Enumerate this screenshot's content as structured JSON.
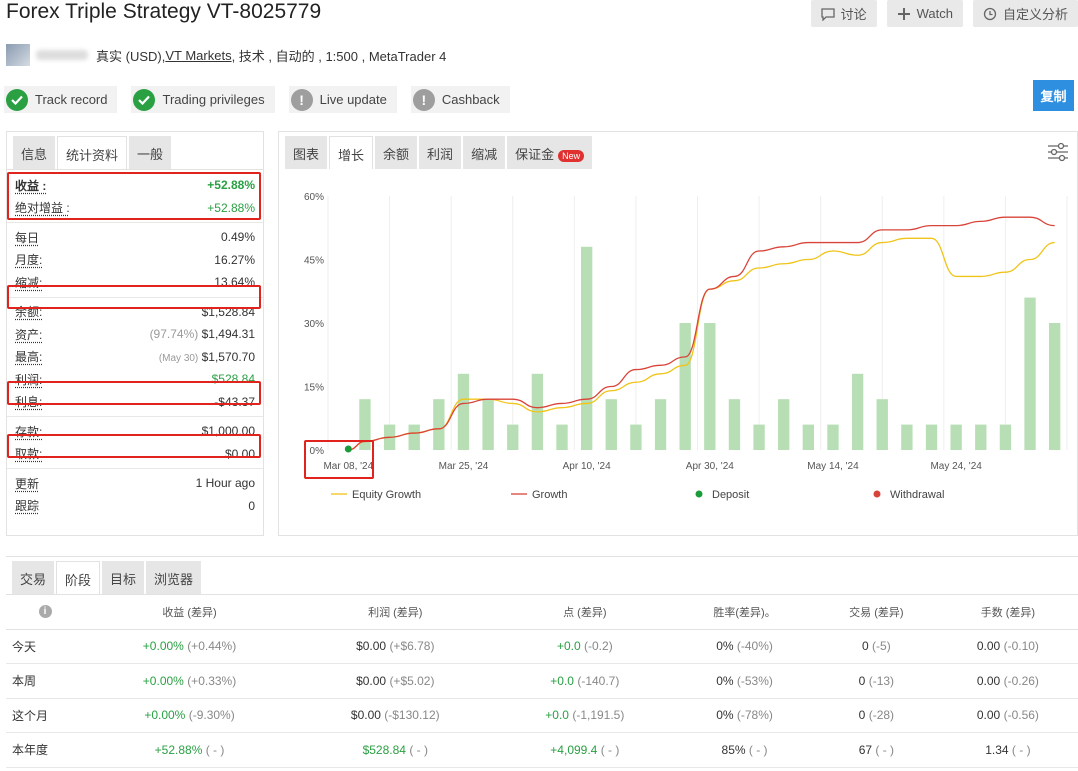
{
  "header": {
    "title": "Forex Triple Strategy VT-8025779",
    "discuss": "讨论",
    "watch": "Watch",
    "custom": "自定义分析"
  },
  "sub": {
    "prefix": "真实 (USD), ",
    "broker": "VT Markets",
    "suffix": " , 技术 , 自动的 , 1:500 , MetaTrader 4"
  },
  "badges": [
    {
      "label": "Track record",
      "status": "ok"
    },
    {
      "label": "Trading privileges",
      "status": "ok"
    },
    {
      "label": "Live update",
      "status": "warn"
    },
    {
      "label": "Cashback",
      "status": "warn"
    }
  ],
  "copy_label": "复制",
  "left_tabs": [
    "信息",
    "统计资料",
    "一般"
  ],
  "stats": {
    "gain": {
      "label": "收益 :",
      "value": "+52.88%"
    },
    "abs_gain": {
      "label": "绝对增益 :",
      "value": "+52.88%"
    },
    "daily": {
      "label": "每日",
      "value": "0.49%"
    },
    "monthly": {
      "label": "月度:",
      "value": "16.27%"
    },
    "drawdown": {
      "label": "缩减:",
      "value": "13.64%"
    },
    "balance": {
      "label": "余额:",
      "value": "$1,528.84"
    },
    "equity": {
      "label": "资产:",
      "pct": "(97.74%)",
      "value": "$1,494.31"
    },
    "highest": {
      "label": "最高:",
      "date": "(May 30)",
      "value": "$1,570.70"
    },
    "profit": {
      "label": "利润:",
      "value": "$528.84"
    },
    "interest": {
      "label": "利息:",
      "value": "-$43.37"
    },
    "deposits": {
      "label": "存款:",
      "value": "$1,000.00"
    },
    "withdrawals": {
      "label": "取款:",
      "value": "$0.00"
    },
    "updated": {
      "label": "更新",
      "value": "1 Hour ago"
    },
    "tracking": {
      "label": "跟踪",
      "value": "0"
    }
  },
  "chart_tabs": [
    "图表",
    "增长",
    "余额",
    "利润",
    "缩减",
    "保证金"
  ],
  "new_badge": "New",
  "chart_data": {
    "type": "line",
    "yticks": [
      "60%",
      "45%",
      "30%",
      "15%",
      "0%"
    ],
    "ylim": [
      0,
      60
    ],
    "xticks": [
      "Mar 08, '24",
      "Mar 25, '24",
      "Apr 10, '24",
      "Apr 30, '24",
      "May 14, '24",
      "May 24, '24"
    ],
    "legend": [
      "Equity Growth",
      "Growth",
      "Deposit",
      "Withdrawal"
    ],
    "colors": {
      "equity": "#f0c419",
      "growth": "#d9443a",
      "deposit": "#1a9c3a",
      "withdrawal": "#d9443a",
      "bars": "#b7deb4"
    },
    "bars": [
      0,
      12,
      6,
      6,
      12,
      18,
      12,
      6,
      18,
      6,
      48,
      12,
      6,
      12,
      30,
      30,
      12,
      6,
      12,
      6,
      6,
      18,
      12,
      6,
      6,
      6,
      6,
      6,
      36,
      30
    ],
    "equity_growth": [
      0,
      2,
      3,
      4,
      5,
      12,
      12,
      11,
      9,
      10,
      11,
      14,
      16,
      18,
      20,
      38,
      40,
      43,
      44,
      45,
      47,
      46,
      49,
      50,
      50,
      41,
      41,
      42,
      45,
      49
    ],
    "growth": [
      0,
      2,
      3,
      4,
      5,
      11,
      12,
      12,
      10,
      11,
      12,
      15,
      19,
      20,
      22,
      38,
      41,
      47,
      48,
      49,
      49,
      49,
      52,
      52,
      53,
      53,
      54,
      55,
      55,
      53
    ]
  },
  "bottom_tabs": [
    "交易",
    "阶段",
    "目标",
    "浏览器"
  ],
  "table": {
    "headers": [
      "收益 (差异)",
      "利润 (差异)",
      "点 (差异)",
      "胜率(差异)。",
      "交易 (差异)",
      "手数 (差异)"
    ],
    "rows": [
      {
        "period": "今天",
        "cells": [
          [
            "+0.00%",
            "(+0.44%)"
          ],
          [
            "$0.00",
            "(+$6.78)"
          ],
          [
            "+0.0",
            "(-0.2)"
          ],
          [
            "0%",
            "(-40%)"
          ],
          [
            "0",
            "(-5)"
          ],
          [
            "0.00",
            "(-0.10)"
          ]
        ]
      },
      {
        "period": "本周",
        "cells": [
          [
            "+0.00%",
            "(+0.33%)"
          ],
          [
            "$0.00",
            "(+$5.02)"
          ],
          [
            "+0.0",
            "(-140.7)"
          ],
          [
            "0%",
            "(-53%)"
          ],
          [
            "0",
            "(-13)"
          ],
          [
            "0.00",
            "(-0.26)"
          ]
        ]
      },
      {
        "period": "这个月",
        "cells": [
          [
            "+0.00%",
            "(-9.30%)"
          ],
          [
            "$0.00",
            "(-$130.12)"
          ],
          [
            "+0.0",
            "(-1,191.5)"
          ],
          [
            "0%",
            "(-78%)"
          ],
          [
            "0",
            "(-28)"
          ],
          [
            "0.00",
            "(-0.56)"
          ]
        ]
      },
      {
        "period": "本年度",
        "cells": [
          [
            "+52.88%",
            "( - )"
          ],
          [
            "$528.84",
            "( - )"
          ],
          [
            "+4,099.4",
            "( - )"
          ],
          [
            "85%",
            "( - )"
          ],
          [
            "67",
            "( - )"
          ],
          [
            "1.34",
            "( - )"
          ]
        ]
      }
    ]
  }
}
